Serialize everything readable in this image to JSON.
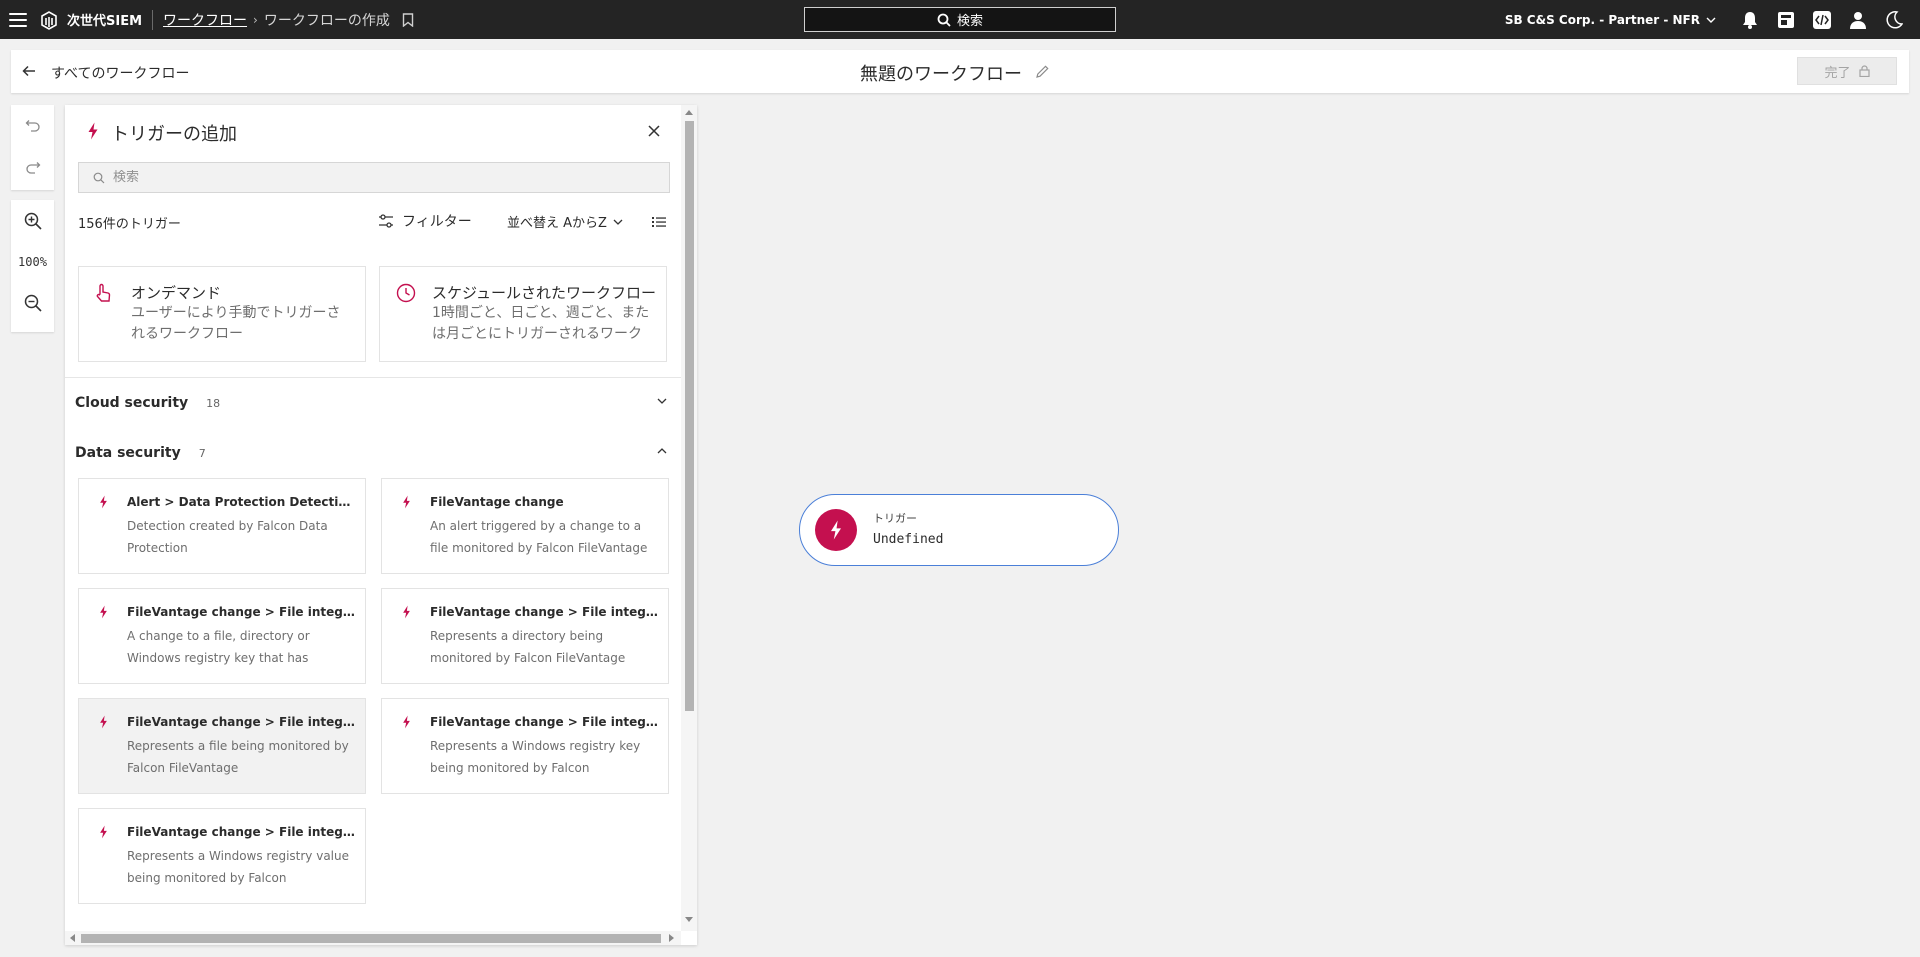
{
  "topbar": {
    "brand": "次世代SIEM",
    "breadcrumb_link": "ワークフロー",
    "breadcrumb_current": "ワークフローの作成",
    "search_label": "検索",
    "org": "SB C&S Corp. - Partner - NFR"
  },
  "header": {
    "back_label": "すべてのワークフロー",
    "title": "無題のワークフロー",
    "done_label": "完了"
  },
  "tools": {
    "zoom": "100%"
  },
  "panel": {
    "title": "トリガーの追加",
    "search_placeholder": "検索",
    "count": "156件のトリガー",
    "filter_label": "フィルター",
    "sort_label": "並べ替え AからZ",
    "featured": [
      {
        "title": "オンデマンド",
        "desc": "ユーザーにより手動でトリガーされるワークフロー"
      },
      {
        "title": "スケジュールされたワークフロー",
        "desc": "1時間ごと、日ごと、週ごと、または月ごとにトリガーされるワークフロー"
      }
    ],
    "sections": [
      {
        "name": "Cloud security",
        "count": "18"
      },
      {
        "name": "Data security",
        "count": "7"
      }
    ],
    "triggers": [
      {
        "title": "Alert > Data Protection Detection",
        "desc": "Detection created by Falcon Data Protection"
      },
      {
        "title": "FileVantage change",
        "desc": "An alert triggered by a change to a file monitored by Falcon FileVantage"
      },
      {
        "title": "FileVantage change > File integrity change",
        "desc": "A change to a file, directory or Windows registry key that has associated policies"
      },
      {
        "title": "FileVantage change > File integrity change",
        "desc": "Represents a directory being monitored by Falcon FileVantage"
      },
      {
        "title": "FileVantage change > File integrity change",
        "desc": "Represents a file being monitored by Falcon FileVantage"
      },
      {
        "title": "FileVantage change > File integrity change",
        "desc": "Represents a Windows registry key being monitored by Falcon FileVantage"
      },
      {
        "title": "FileVantage change > File integrity change",
        "desc": "Represents a Windows registry value being monitored by Falcon FileVantage"
      }
    ]
  },
  "node": {
    "label": "トリガー",
    "value": "Undefined"
  },
  "colors": {
    "accent": "#c4104f",
    "node_border": "#4a7fd8",
    "topbar": "#242424"
  },
  "icons": [
    "menu-icon",
    "logo-icon",
    "bookmark-icon",
    "search-icon",
    "chevron-down-icon",
    "bell-icon",
    "dashboard-icon",
    "code-icon",
    "user-icon",
    "moon-icon",
    "back-arrow-icon",
    "pencil-icon",
    "lock-icon",
    "undo-icon",
    "redo-icon",
    "zoom-in-icon",
    "zoom-out-icon",
    "bolt-icon",
    "close-icon",
    "filter-icon",
    "list-view-icon",
    "touch-icon",
    "clock-icon"
  ]
}
